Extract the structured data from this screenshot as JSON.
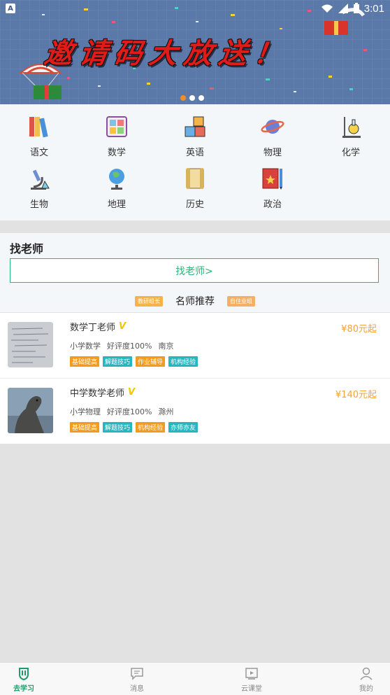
{
  "status_bar": {
    "time": "3:01",
    "app_icon": "A"
  },
  "banner": {
    "title": "邀请码大放送！",
    "page_count": 3,
    "active_page": 1
  },
  "subjects": [
    {
      "label": "语文",
      "icon": "books-icon"
    },
    {
      "label": "数学",
      "icon": "calculator-icon"
    },
    {
      "label": "英语",
      "icon": "abc-blocks-icon"
    },
    {
      "label": "物理",
      "icon": "planet-icon"
    },
    {
      "label": "化学",
      "icon": "flask-stand-icon"
    },
    {
      "label": "生物",
      "icon": "microscope-icon"
    },
    {
      "label": "地理",
      "icon": "globe-icon"
    },
    {
      "label": "历史",
      "icon": "scroll-icon"
    },
    {
      "label": "政治",
      "icon": "book-pencil-icon"
    }
  ],
  "find_teacher": {
    "title": "找老师",
    "button_label": "找老师>",
    "recommend_title": "名师推荐",
    "left_badge": "教研组长",
    "right_badge": "自住业组"
  },
  "teachers": [
    {
      "name": "数学丁老师",
      "subject": "小学数学",
      "rating": "好评度100%",
      "location": "南京",
      "price": "¥80元起",
      "tags": [
        {
          "label": "基础提高",
          "color": "orange"
        },
        {
          "label": "解题技巧",
          "color": "teal"
        },
        {
          "label": "作业辅导",
          "color": "orange"
        },
        {
          "label": "机构经验",
          "color": "teal"
        }
      ]
    },
    {
      "name": "中学数学老师",
      "subject": "小学物理",
      "rating": "好评度100%",
      "location": "滁州",
      "price": "¥140元起",
      "tags": [
        {
          "label": "基础提高",
          "color": "orange"
        },
        {
          "label": "解题技巧",
          "color": "teal"
        },
        {
          "label": "机构经验",
          "color": "orange"
        },
        {
          "label": "亦师亦友",
          "color": "teal"
        }
      ]
    }
  ],
  "tabbar": [
    {
      "label": "去学习",
      "icon": "shield-book-icon",
      "active": true
    },
    {
      "label": "消息",
      "icon": "message-icon",
      "active": false
    },
    {
      "label": "云课堂",
      "icon": "video-play-icon",
      "active": false
    },
    {
      "label": "我的",
      "icon": "person-icon",
      "active": false
    }
  ],
  "colors": {
    "accent": "#27b87a",
    "price": "#f3a33a",
    "tag_orange": "#f29b1f",
    "tag_teal": "#26b6c0"
  }
}
